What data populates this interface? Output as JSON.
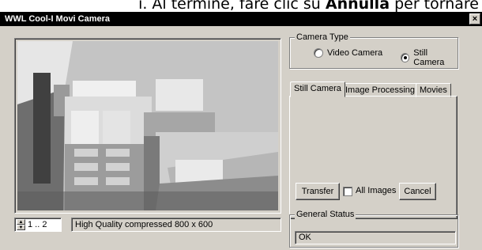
{
  "document_fragment": {
    "text_before": "i. Al termine, fare clic su ",
    "bold_word": "Annulla",
    "text_after": " per tornare"
  },
  "window": {
    "title": "WWL Cool-I Movi Camera",
    "close_glyph": "×"
  },
  "preview": {
    "frame_label": "1 .. 2",
    "quality_text": "High Quality compressed 800 x 600"
  },
  "camera_type": {
    "group_label": "Camera Type",
    "options": [
      {
        "label": "Video Camera",
        "selected": false
      },
      {
        "label": "Still Camera",
        "selected": true
      }
    ]
  },
  "tabs": [
    {
      "label": "Still Camera",
      "active": true
    },
    {
      "label": "Image Processing",
      "active": false
    },
    {
      "label": "Movies",
      "active": false
    }
  ],
  "still_camera_panel": {
    "transfer_label": "Transfer",
    "all_images_label": "All Images",
    "all_images_checked": false,
    "cancel_label": "Cancel"
  },
  "general_status": {
    "group_label": "General Status",
    "value": "OK"
  },
  "colors": {
    "face": "#d4d0c8",
    "titlebar": "#000000"
  }
}
